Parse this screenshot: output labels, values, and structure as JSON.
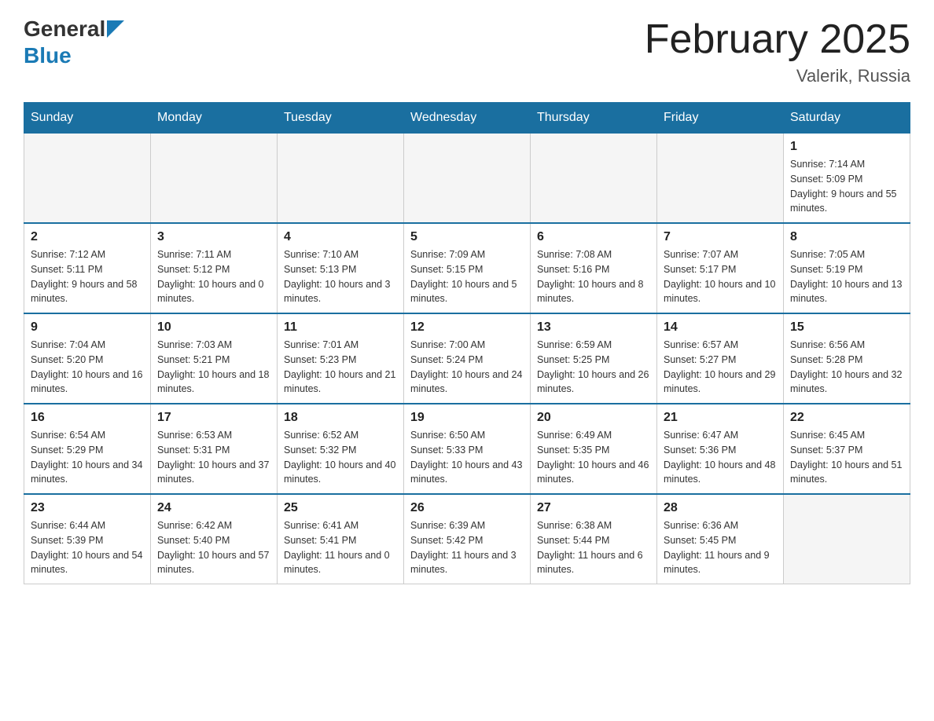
{
  "header": {
    "logo_general": "General",
    "logo_blue": "Blue",
    "title": "February 2025",
    "subtitle": "Valerik, Russia"
  },
  "weekdays": [
    "Sunday",
    "Monday",
    "Tuesday",
    "Wednesday",
    "Thursday",
    "Friday",
    "Saturday"
  ],
  "weeks": [
    [
      {
        "day": "",
        "info": ""
      },
      {
        "day": "",
        "info": ""
      },
      {
        "day": "",
        "info": ""
      },
      {
        "day": "",
        "info": ""
      },
      {
        "day": "",
        "info": ""
      },
      {
        "day": "",
        "info": ""
      },
      {
        "day": "1",
        "info": "Sunrise: 7:14 AM\nSunset: 5:09 PM\nDaylight: 9 hours and 55 minutes."
      }
    ],
    [
      {
        "day": "2",
        "info": "Sunrise: 7:12 AM\nSunset: 5:11 PM\nDaylight: 9 hours and 58 minutes."
      },
      {
        "day": "3",
        "info": "Sunrise: 7:11 AM\nSunset: 5:12 PM\nDaylight: 10 hours and 0 minutes."
      },
      {
        "day": "4",
        "info": "Sunrise: 7:10 AM\nSunset: 5:13 PM\nDaylight: 10 hours and 3 minutes."
      },
      {
        "day": "5",
        "info": "Sunrise: 7:09 AM\nSunset: 5:15 PM\nDaylight: 10 hours and 5 minutes."
      },
      {
        "day": "6",
        "info": "Sunrise: 7:08 AM\nSunset: 5:16 PM\nDaylight: 10 hours and 8 minutes."
      },
      {
        "day": "7",
        "info": "Sunrise: 7:07 AM\nSunset: 5:17 PM\nDaylight: 10 hours and 10 minutes."
      },
      {
        "day": "8",
        "info": "Sunrise: 7:05 AM\nSunset: 5:19 PM\nDaylight: 10 hours and 13 minutes."
      }
    ],
    [
      {
        "day": "9",
        "info": "Sunrise: 7:04 AM\nSunset: 5:20 PM\nDaylight: 10 hours and 16 minutes."
      },
      {
        "day": "10",
        "info": "Sunrise: 7:03 AM\nSunset: 5:21 PM\nDaylight: 10 hours and 18 minutes."
      },
      {
        "day": "11",
        "info": "Sunrise: 7:01 AM\nSunset: 5:23 PM\nDaylight: 10 hours and 21 minutes."
      },
      {
        "day": "12",
        "info": "Sunrise: 7:00 AM\nSunset: 5:24 PM\nDaylight: 10 hours and 24 minutes."
      },
      {
        "day": "13",
        "info": "Sunrise: 6:59 AM\nSunset: 5:25 PM\nDaylight: 10 hours and 26 minutes."
      },
      {
        "day": "14",
        "info": "Sunrise: 6:57 AM\nSunset: 5:27 PM\nDaylight: 10 hours and 29 minutes."
      },
      {
        "day": "15",
        "info": "Sunrise: 6:56 AM\nSunset: 5:28 PM\nDaylight: 10 hours and 32 minutes."
      }
    ],
    [
      {
        "day": "16",
        "info": "Sunrise: 6:54 AM\nSunset: 5:29 PM\nDaylight: 10 hours and 34 minutes."
      },
      {
        "day": "17",
        "info": "Sunrise: 6:53 AM\nSunset: 5:31 PM\nDaylight: 10 hours and 37 minutes."
      },
      {
        "day": "18",
        "info": "Sunrise: 6:52 AM\nSunset: 5:32 PM\nDaylight: 10 hours and 40 minutes."
      },
      {
        "day": "19",
        "info": "Sunrise: 6:50 AM\nSunset: 5:33 PM\nDaylight: 10 hours and 43 minutes."
      },
      {
        "day": "20",
        "info": "Sunrise: 6:49 AM\nSunset: 5:35 PM\nDaylight: 10 hours and 46 minutes."
      },
      {
        "day": "21",
        "info": "Sunrise: 6:47 AM\nSunset: 5:36 PM\nDaylight: 10 hours and 48 minutes."
      },
      {
        "day": "22",
        "info": "Sunrise: 6:45 AM\nSunset: 5:37 PM\nDaylight: 10 hours and 51 minutes."
      }
    ],
    [
      {
        "day": "23",
        "info": "Sunrise: 6:44 AM\nSunset: 5:39 PM\nDaylight: 10 hours and 54 minutes."
      },
      {
        "day": "24",
        "info": "Sunrise: 6:42 AM\nSunset: 5:40 PM\nDaylight: 10 hours and 57 minutes."
      },
      {
        "day": "25",
        "info": "Sunrise: 6:41 AM\nSunset: 5:41 PM\nDaylight: 11 hours and 0 minutes."
      },
      {
        "day": "26",
        "info": "Sunrise: 6:39 AM\nSunset: 5:42 PM\nDaylight: 11 hours and 3 minutes."
      },
      {
        "day": "27",
        "info": "Sunrise: 6:38 AM\nSunset: 5:44 PM\nDaylight: 11 hours and 6 minutes."
      },
      {
        "day": "28",
        "info": "Sunrise: 6:36 AM\nSunset: 5:45 PM\nDaylight: 11 hours and 9 minutes."
      },
      {
        "day": "",
        "info": ""
      }
    ]
  ]
}
